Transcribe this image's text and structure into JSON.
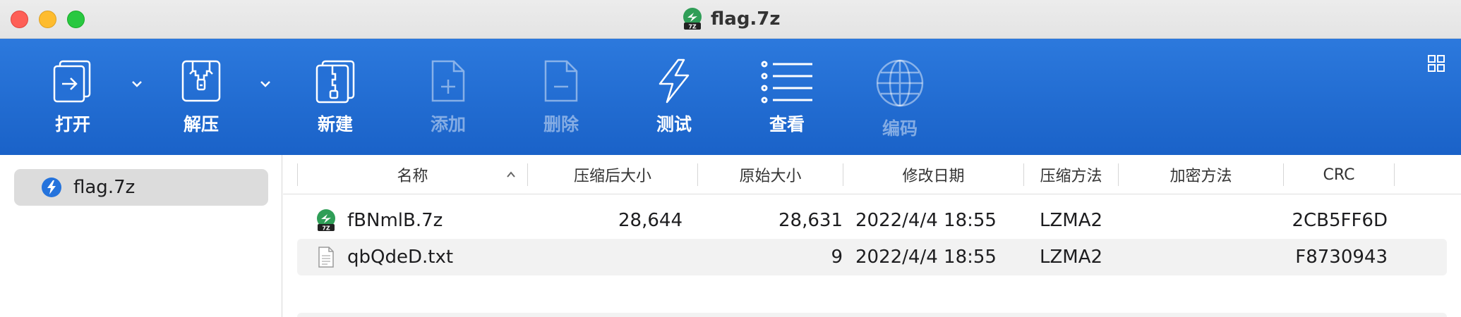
{
  "window": {
    "title": "flag.7z"
  },
  "toolbar": {
    "items": [
      {
        "label": "打开",
        "icon": "open-icon",
        "enabled": true
      },
      {
        "label": "解压",
        "icon": "extract-icon",
        "enabled": true
      },
      {
        "label": "新建",
        "icon": "new-archive-icon",
        "enabled": true
      },
      {
        "label": "添加",
        "icon": "add-file-icon",
        "enabled": false
      },
      {
        "label": "删除",
        "icon": "delete-file-icon",
        "enabled": false
      },
      {
        "label": "测试",
        "icon": "lightning-icon",
        "enabled": true
      },
      {
        "label": "查看",
        "icon": "list-view-icon",
        "enabled": true
      },
      {
        "label": "编码",
        "icon": "globe-icon",
        "enabled": false
      }
    ]
  },
  "sidebar": {
    "items": [
      {
        "label": "flag.7z",
        "icon": "archive-icon",
        "selected": true
      }
    ]
  },
  "table": {
    "columns": [
      "名称",
      "压缩后大小",
      "原始大小",
      "修改日期",
      "压缩方法",
      "加密方法",
      "CRC"
    ],
    "sort": {
      "column": "名称",
      "direction": "ascending"
    },
    "rows": [
      {
        "name": "fBNmlB.7z",
        "icon": "7z-archive-icon",
        "compressed": "28,644",
        "original": "28,631",
        "modified": "2022/4/4 18:55",
        "method": "LZMA2",
        "encryption": "",
        "crc": "2CB5FF6D"
      },
      {
        "name": "qbQdeD.txt",
        "icon": "text-file-icon",
        "compressed": "",
        "original": "9",
        "modified": "2022/4/4 18:55",
        "method": "LZMA2",
        "encryption": "",
        "crc": "F8730943"
      }
    ]
  },
  "colors": {
    "toolbar_top": "#2c79dd",
    "toolbar_bottom": "#1a62c8",
    "selection": "#dcdcdc",
    "archive_green": "#2f9e57"
  }
}
